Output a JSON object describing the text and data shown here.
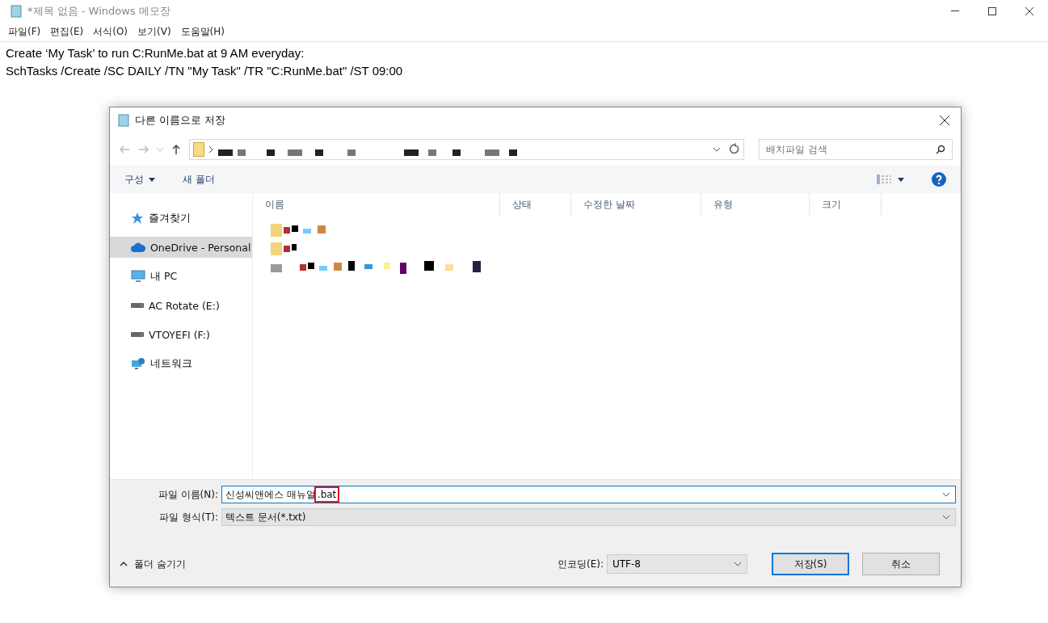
{
  "notepad": {
    "title": "*제목 없음 - Windows 메모장",
    "menu": [
      "파일(F)",
      "편집(E)",
      "서식(O)",
      "보기(V)",
      "도움말(H)"
    ],
    "lines": [
      "Create ‘My Task’ to run C:RunMe.bat at 9 AM everyday:",
      "SchTasks /Create /SC DAILY /TN \"My Task\" /TR \"C:RunMe.bat\" /ST 09:00"
    ]
  },
  "dialog": {
    "title": "다른 이름으로 저장",
    "search": {
      "placeholder": "배치파일 검색"
    },
    "toolbar": {
      "organize": "구성",
      "new_folder": "새 폴더"
    },
    "sidebar": [
      {
        "label": "즐겨찾기",
        "kind": "star",
        "selected": false
      },
      {
        "label": "OneDrive - Personal",
        "kind": "cloud",
        "selected": true
      },
      {
        "label": "내 PC",
        "kind": "pc",
        "selected": false
      },
      {
        "label": "AC Rotate (E:)",
        "kind": "drive",
        "selected": false
      },
      {
        "label": "VTOYEFI (F:)",
        "kind": "drive",
        "selected": false
      },
      {
        "label": "네트워크",
        "kind": "network",
        "selected": false
      }
    ],
    "columns": [
      "이름",
      "상태",
      "수정한 날짜",
      "유형",
      "크기"
    ],
    "file_rows": [
      {
        "kind": "folder"
      },
      {
        "kind": "folder"
      },
      {
        "kind": "file"
      }
    ],
    "filename": {
      "label": "파일 이름(N):",
      "parts": [
        {
          "text": "신성씨앤에스 매뉴얼",
          "highlighted": false
        },
        {
          "text": ".bat",
          "highlighted": true
        }
      ]
    },
    "filetype": {
      "label": "파일 형식(T):",
      "value": "텍스트 문서(*.txt)"
    },
    "hide_folders": "폴더 숨기기",
    "encoding": {
      "label": "인코딩(E):",
      "value": "UTF-8"
    },
    "buttons": [
      {
        "label": "저장(S)",
        "kind": "default"
      },
      {
        "label": "취소",
        "kind": "normal"
      }
    ]
  }
}
